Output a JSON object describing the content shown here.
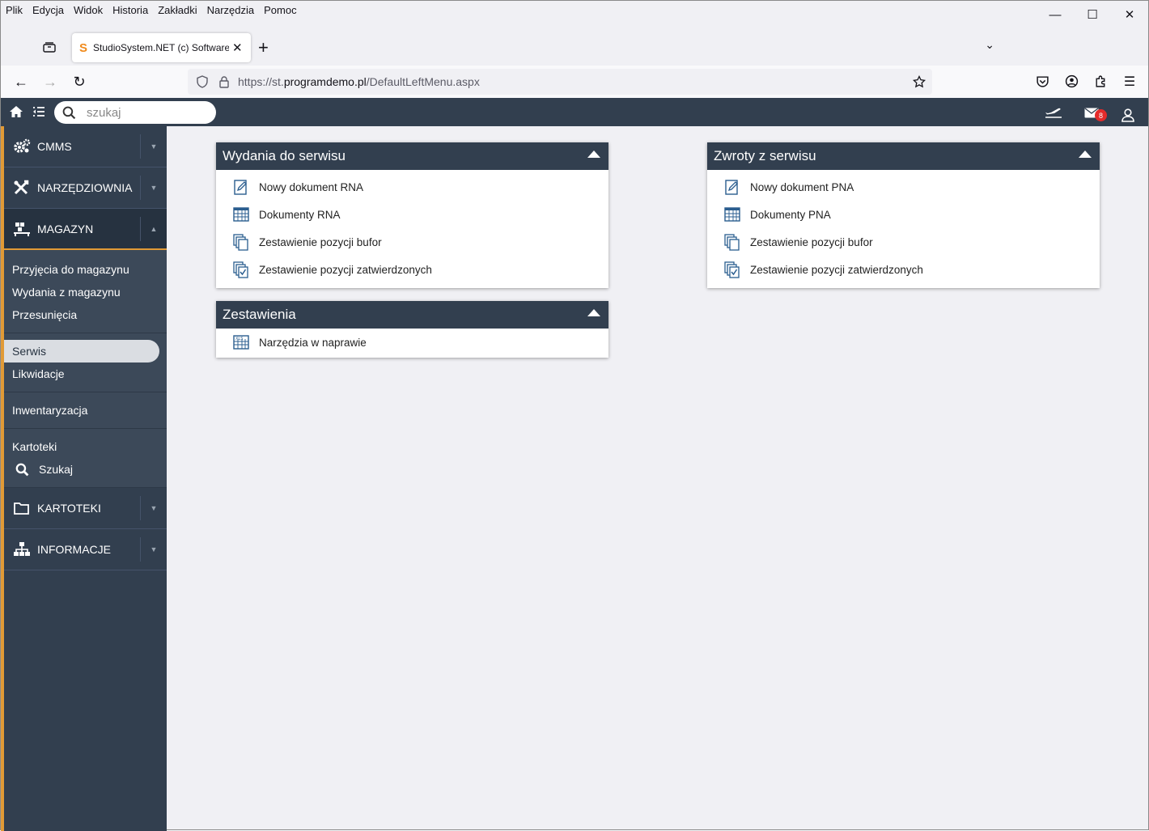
{
  "browser": {
    "menu": [
      "Plik",
      "Edycja",
      "Widok",
      "Historia",
      "Zakładki",
      "Narzędzia",
      "Pomoc"
    ],
    "tab_title": "StudioSystem.NET (c) SoftwareS",
    "url_prefix": "https://st.",
    "url_domain": "programdemo.pl",
    "url_path": "/DefaultLeftMenu.aspx"
  },
  "app": {
    "search_placeholder": "szukaj",
    "mail_count": "8"
  },
  "sidebar": {
    "sections": [
      {
        "label": "CMMS",
        "icon": "gears-icon"
      },
      {
        "label": "NARZĘDZIOWNIA",
        "icon": "tools-icon"
      },
      {
        "label": "MAGAZYN",
        "icon": "warehouse-icon"
      }
    ],
    "sub_groups": [
      [
        "Przyjęcia do magazynu",
        "Wydania z magazynu",
        "Przesunięcia"
      ],
      [
        "Serwis",
        "Likwidacje"
      ],
      [
        "Inwentaryzacja"
      ],
      [
        "Kartoteki",
        "Szukaj"
      ]
    ],
    "bottom_sections": [
      {
        "label": "KARTOTEKI",
        "icon": "folder-icon"
      },
      {
        "label": "INFORMACJE",
        "icon": "sitemap-icon"
      }
    ]
  },
  "panels": {
    "wydania": {
      "title": "Wydania do serwisu",
      "items": [
        "Nowy dokument RNA",
        "Dokumenty RNA",
        "Zestawienie pozycji bufor",
        "Zestawienie pozycji zatwierdzonych"
      ]
    },
    "zwroty": {
      "title": "Zwroty z serwisu",
      "items": [
        "Nowy dokument PNA",
        "Dokumenty PNA",
        "Zestawienie pozycji bufor",
        "Zestawienie pozycji zatwierdzonych"
      ]
    },
    "zestawienia": {
      "title": "Zestawienia",
      "items": [
        "Narzędzia w naprawie"
      ]
    }
  },
  "colors": {
    "app_dark": "#323f4f",
    "accent": "#e19a36",
    "badge": "#e52b2b"
  }
}
